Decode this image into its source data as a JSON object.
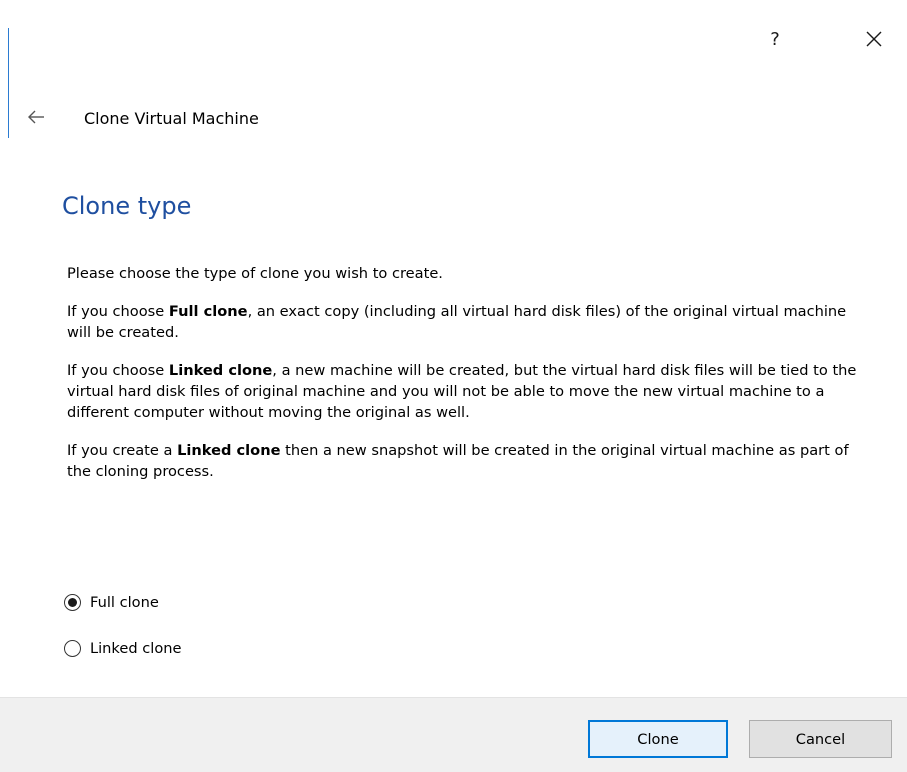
{
  "window": {
    "help_label": "?",
    "close_icon": "close-icon",
    "back_icon": "back-arrow-icon"
  },
  "wizard": {
    "title": "Clone Virtual Machine"
  },
  "page": {
    "heading": "Clone type",
    "intro": "Please choose the type of clone you wish to create.",
    "full_para": {
      "before": "If you choose ",
      "bold": "Full clone",
      "after": ", an exact copy (including all virtual hard disk files) of the original virtual machine will be created."
    },
    "linked_para": {
      "before": "If you choose ",
      "bold": "Linked clone",
      "after": ", a new machine will be created, but the virtual hard disk files will be tied to the virtual hard disk files of original machine and you will not be able to move the new virtual machine to a different computer without moving the original as well."
    },
    "snapshot_para": {
      "before": "If you create a ",
      "bold": "Linked clone",
      "after": " then a new snapshot will be created in the original virtual machine as part of the cloning process."
    }
  },
  "options": [
    {
      "label": "Full clone",
      "selected": true
    },
    {
      "label": "Linked clone",
      "selected": false
    }
  ],
  "buttons": {
    "clone_label": "Clone",
    "cancel_label": "Cancel"
  },
  "colors": {
    "heading": "#1f4fa0",
    "accent": "#0078d7",
    "footer_bg": "#f0f0f0"
  }
}
